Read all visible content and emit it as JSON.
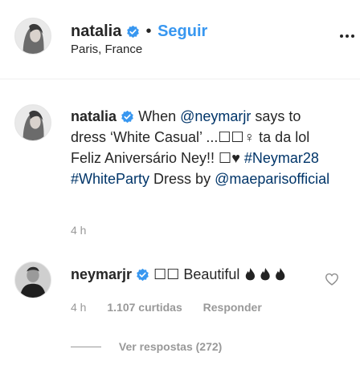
{
  "header": {
    "username": "natalia",
    "dot": "•",
    "follow_label": "Seguir",
    "location": "Paris, France",
    "more_icon": "more-horizontal-icon"
  },
  "caption": {
    "username": "natalia",
    "text_1": "When ",
    "mention_1": "@neymarjr",
    "text_2": " says to dress ‘White Casual’ ...☐☐♀ ta da lol Feliz Aniversário Ney!! ☐♥ ",
    "hashtag_1": "#Neymar28",
    "text_3": " ",
    "hashtag_2": "#WhiteParty",
    "text_4": " Dress by ",
    "mention_2": "@maeparisofficial",
    "time": "4 h"
  },
  "comment": {
    "username": "neymarjr",
    "text": "☐☐ Beautiful ",
    "emoji_icon": "fire-icon",
    "time": "4 h",
    "likes": "1.107 curtidas",
    "reply_label": "Responder",
    "heart_icon": "heart-icon",
    "view_replies": "Ver respostas (272)"
  },
  "colors": {
    "accent": "#3897f0",
    "link": "#003569",
    "text": "#262626",
    "muted": "#999999"
  }
}
